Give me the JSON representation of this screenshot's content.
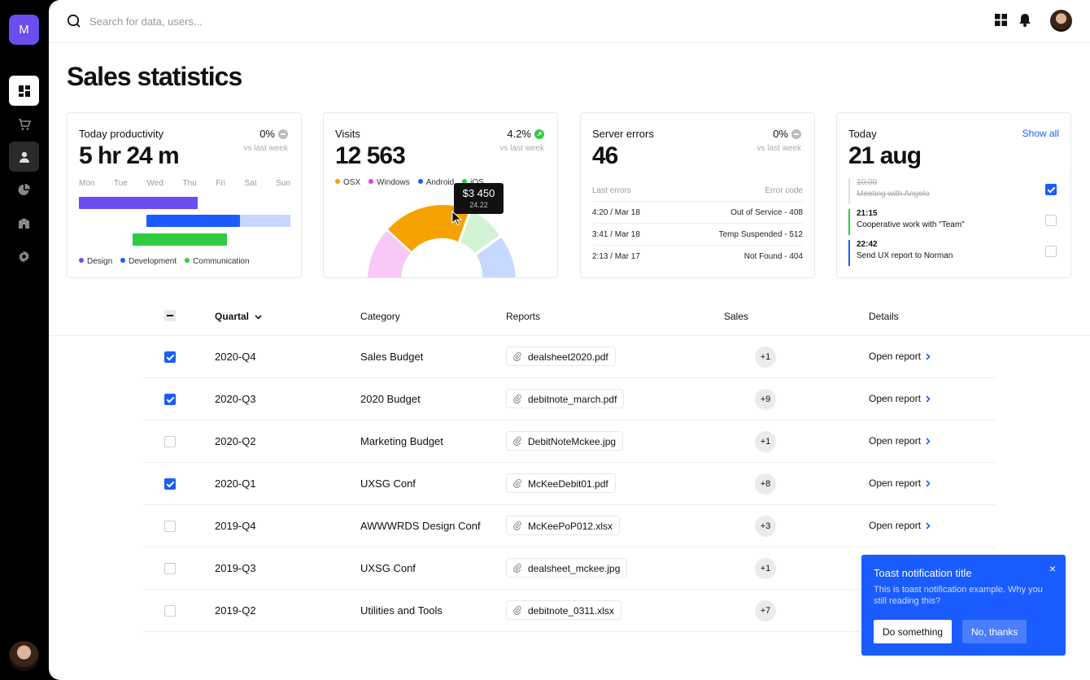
{
  "sidebar": {
    "logo_letter": "M",
    "items": [
      {
        "icon": "dashboard-icon",
        "active": true
      },
      {
        "icon": "cart-icon",
        "active": false
      },
      {
        "icon": "user-icon",
        "active": false
      },
      {
        "icon": "pie-chart-icon",
        "active": false
      },
      {
        "icon": "bank-icon",
        "active": false
      },
      {
        "icon": "gear-icon",
        "active": false
      }
    ]
  },
  "topbar": {
    "search_placeholder": "Search for data, users..."
  },
  "page": {
    "title": "Sales statistics"
  },
  "productivity": {
    "label": "Today productivity",
    "value": "5 hr 24 m",
    "change": "0%",
    "compare": "vs last week",
    "days": [
      "Mon",
      "Tue",
      "Wed",
      "Thu",
      "Fri",
      "Sat",
      "Sun"
    ],
    "legend": [
      {
        "label": "Design",
        "color": "#6b4df0"
      },
      {
        "label": "Development",
        "color": "#1a5cff"
      },
      {
        "label": "Communication",
        "color": "#2ecc40"
      }
    ]
  },
  "visits": {
    "label": "Visits",
    "value": "12 563",
    "change": "4.2%",
    "compare": "vs last week",
    "legend": [
      {
        "label": "OSX",
        "color": "#f5a100"
      },
      {
        "label": "Windows",
        "color": "#e83be8"
      },
      {
        "label": "Android",
        "color": "#1a5cff"
      },
      {
        "label": "iOS",
        "color": "#2ecc40"
      }
    ],
    "tooltip_value": "$3 450",
    "tooltip_sub": "24.22"
  },
  "errors": {
    "label": "Server errors",
    "value": "46",
    "change": "0%",
    "compare": "vs last week",
    "col_left": "Last errors",
    "col_right": "Error code",
    "rows": [
      {
        "time": "4:20 / Mar 18",
        "code": "Out of Service - 408"
      },
      {
        "time": "3:41 / Mar 18",
        "code": "Temp Suspended - 512"
      },
      {
        "time": "2:13 / Mar 17",
        "code": "Not Found - 404"
      }
    ]
  },
  "today": {
    "label": "Today",
    "date": "21 aug",
    "show_all": "Show all",
    "tasks": [
      {
        "time": "10:00",
        "desc": "Meeting with Angelo"
      },
      {
        "time": "21:15",
        "desc": "Cooperative work with \"Team\""
      },
      {
        "time": "22:42",
        "desc": "Send UX report to Norman"
      }
    ]
  },
  "table": {
    "headers": {
      "quartal": "Quartal",
      "category": "Category",
      "reports": "Reports",
      "sales": "Sales",
      "details": "Details"
    },
    "rows": [
      {
        "quartal": "2020-Q4",
        "category": "Sales Budget",
        "report": "dealsheet2020.pdf",
        "sales": "+1",
        "details": "Open report"
      },
      {
        "quartal": "2020-Q3",
        "category": "2020 Budget",
        "report": "debitnote_march.pdf",
        "sales": "+9",
        "details": "Open report"
      },
      {
        "quartal": "2020-Q2",
        "category": "Marketing Budget",
        "report": "DebitNoteMckee.jpg",
        "sales": "+1",
        "details": "Open report"
      },
      {
        "quartal": "2020-Q1",
        "category": "UXSG Conf",
        "report": "McKeeDebit01.pdf",
        "sales": "+8",
        "details": "Open report"
      },
      {
        "quartal": "2019-Q4",
        "category": "AWWWRDS Design Conf",
        "report": "McKeePoP012.xlsx",
        "sales": "+3",
        "details": "Open report"
      },
      {
        "quartal": "2019-Q3",
        "category": "UXSG Conf",
        "report": "dealsheet_mckee.jpg",
        "sales": "+1",
        "details": ""
      },
      {
        "quartal": "2019-Q2",
        "category": "Utilities and Tools",
        "report": "debitnote_0311.xlsx",
        "sales": "+7",
        "details": ""
      }
    ]
  },
  "toast": {
    "title": "Toast notification title",
    "body": "This is toast notification example. Why you still reading this?",
    "close": "×",
    "primary": "Do something",
    "secondary": "No, thanks"
  }
}
